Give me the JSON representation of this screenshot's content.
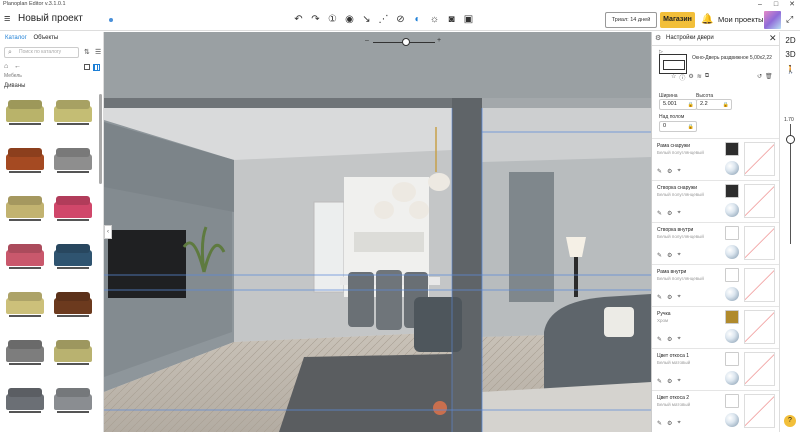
{
  "app": {
    "window_title": "Planoplan Editor v.3.1.0.1"
  },
  "window_controls": [
    "–",
    "□",
    "✕"
  ],
  "toolbar": {
    "menu_glyph": "≡",
    "project_title": "Новый проект",
    "tools": [
      {
        "name": "undo-icon",
        "glyph": "↶"
      },
      {
        "name": "redo-icon",
        "glyph": "↷"
      },
      {
        "name": "info-icon",
        "glyph": "①"
      },
      {
        "name": "eye-icon",
        "glyph": "◉"
      },
      {
        "name": "measure-icon",
        "glyph": "↘"
      },
      {
        "name": "hatch-icon",
        "glyph": "⋰"
      },
      {
        "name": "link-icon",
        "glyph": "⊘"
      },
      {
        "name": "walk-mode-icon",
        "glyph": "◐"
      },
      {
        "name": "sun-icon",
        "glyph": "☼"
      },
      {
        "name": "camera-icon",
        "glyph": "◙"
      },
      {
        "name": "gallery-icon",
        "glyph": "▣"
      }
    ],
    "trial_label": "Триал: 14 дней",
    "shop_label": "Магазин",
    "bell_glyph": "🔔",
    "my_projects_label": "Мои проекты",
    "expand_glyph": "⤢"
  },
  "catalog": {
    "tabs": [
      "Каталог",
      "Объекты"
    ],
    "search_placeholder": "Поиск по каталогу",
    "breadcrumb": "Мебель",
    "category_title": "Диваны",
    "collapse_glyph": "‹",
    "items": [
      {
        "color": "#b9b36a"
      },
      {
        "color": "#c4bd74"
      },
      {
        "color": "#a54a22"
      },
      {
        "color": "#8e8e8e"
      },
      {
        "color": "#c2b370"
      },
      {
        "color": "#d0476a"
      },
      {
        "color": "#c9586c"
      },
      {
        "color": "#2f5470"
      },
      {
        "color": "#ccc07a"
      },
      {
        "color": "#6c3a1e"
      },
      {
        "color": "#7d7d7d"
      },
      {
        "color": "#b9b270"
      },
      {
        "color": "#6b6f75"
      },
      {
        "color": "#8a8d91"
      }
    ]
  },
  "viewport": {
    "zoom_minus": "–",
    "zoom_plus": "+"
  },
  "door_panel": {
    "title": "Настройки двери",
    "door_name": "Окно-Дверь раздвижное 5,00х2,22",
    "width_label": "Ширина",
    "width_value": "5.001",
    "height_label": "Высота",
    "height_value": "2.2",
    "floor_label": "Над полом",
    "floor_value": "0",
    "materials": [
      {
        "name": "Рама снаружи",
        "sub": "Белый полуглянцевый",
        "swatch": "#2d2d2d"
      },
      {
        "name": "Створка снаружи",
        "sub": "Белый полуглянцевый",
        "swatch": "#2d2d2d"
      },
      {
        "name": "Створка внутри",
        "sub": "Белый полуглянцевый",
        "swatch": "#ffffff"
      },
      {
        "name": "Рама внутри",
        "sub": "Белый полуглянцевый",
        "swatch": "#ffffff"
      },
      {
        "name": "Ручка",
        "sub": "Хром",
        "swatch": "#b08a2c"
      },
      {
        "name": "Цвет откоса 1",
        "sub": "Белый матовый",
        "swatch": "#ffffff"
      },
      {
        "name": "Цвет откоса 2",
        "sub": "Белый матовый",
        "swatch": "#ffffff"
      }
    ]
  },
  "view_strip": {
    "btn_2d": "2D",
    "btn_3d": "3D",
    "height_value": "1.70",
    "help": "?"
  }
}
